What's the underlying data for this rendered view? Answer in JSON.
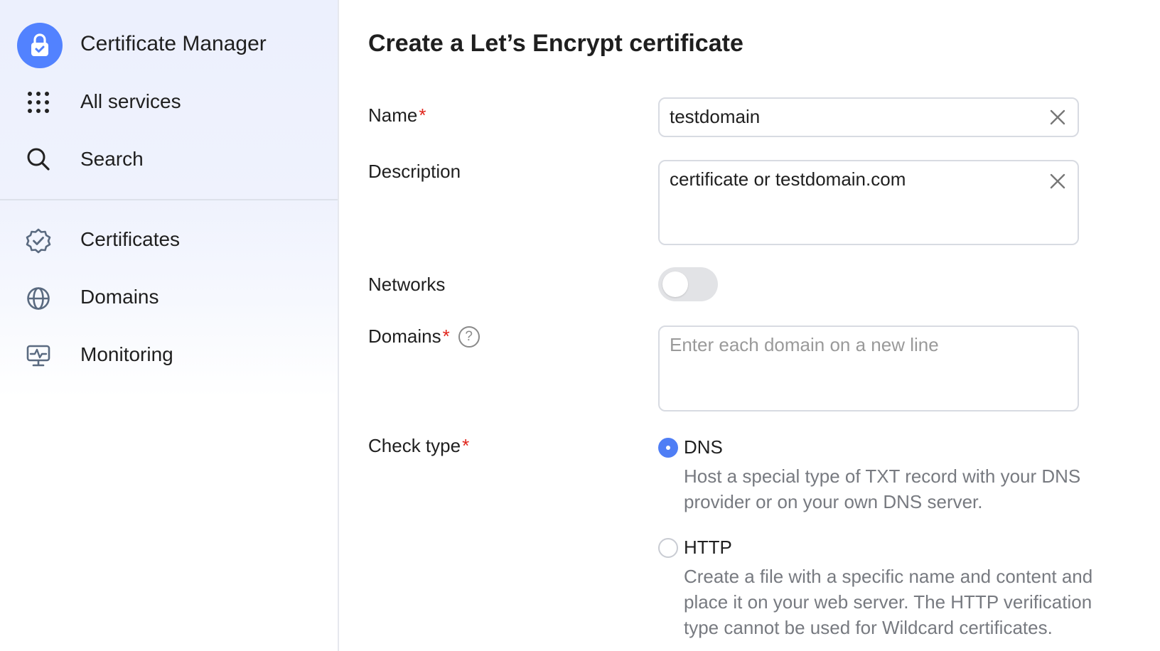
{
  "sidebar": {
    "brand": "Certificate Manager",
    "nav_top": [
      {
        "label": "All services",
        "icon": "grid-icon"
      },
      {
        "label": "Search",
        "icon": "search-icon"
      }
    ],
    "nav": [
      {
        "label": "Certificates",
        "icon": "badge-check-icon"
      },
      {
        "label": "Domains",
        "icon": "globe-icon"
      },
      {
        "label": "Monitoring",
        "icon": "monitor-pulse-icon"
      }
    ]
  },
  "form": {
    "title": "Create a Let’s Encrypt certificate",
    "name": {
      "label": "Name",
      "required": "*",
      "value": "testdomain"
    },
    "description": {
      "label": "Description",
      "value": "certificate or testdomain.com"
    },
    "networks": {
      "label": "Networks",
      "enabled": false
    },
    "domains": {
      "label": "Domains",
      "required": "*",
      "help": "?",
      "placeholder": "Enter each domain on a new line"
    },
    "check_type": {
      "label": "Check type",
      "required": "*",
      "options": [
        {
          "label": "DNS",
          "selected": true,
          "description": "Host a special type of TXT record with your DNS provider or on your own DNS server."
        },
        {
          "label": "HTTP",
          "selected": false,
          "description": "Create a file with a specific name and content and place it on your web server. The HTTP verification type cannot be used for Wildcard certificates."
        }
      ]
    }
  },
  "colors": {
    "accent": "#5282ff",
    "radio_selected": "#4f7ef5",
    "required": "#e0241b",
    "sidebar_bg": "#ecf0fd"
  }
}
